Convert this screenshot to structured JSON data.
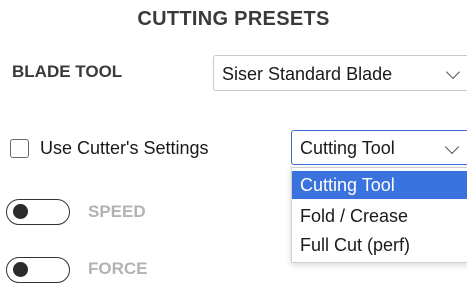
{
  "panel": {
    "title": "CUTTING PRESETS"
  },
  "blade_tool": {
    "label": "BLADE TOOL",
    "selected": "Siser Standard Blade",
    "chevron_icon": "chevron-down-icon"
  },
  "cutter_settings": {
    "label": "Use Cutter's Settings",
    "checked": false
  },
  "cutting_tool": {
    "selected": "Cutting Tool",
    "chevron_icon": "chevron-down-icon",
    "options": [
      "Cutting Tool",
      "Fold / Crease",
      "Full Cut (perf)"
    ]
  },
  "speed": {
    "label": "SPEED",
    "enabled": false
  },
  "force": {
    "label": "FORCE",
    "enabled": false
  },
  "colors": {
    "selection_highlight": "#3a73de",
    "focus_border": "#3b6fd6",
    "disabled_label": "#b3b3b3"
  }
}
